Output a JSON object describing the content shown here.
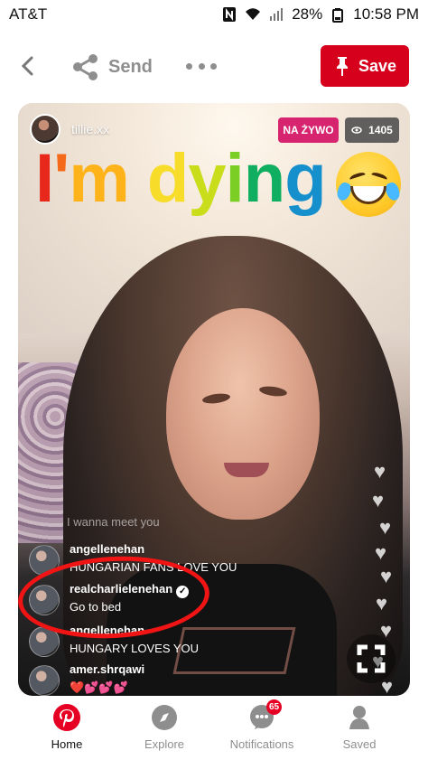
{
  "status_bar": {
    "carrier": "AT&T",
    "battery": "28%",
    "time": "10:58 PM"
  },
  "toolbar": {
    "send_label": "Send",
    "save_label": "Save"
  },
  "live_stream": {
    "username": "tillie.xx",
    "live_badge": "NA ŻYWO",
    "viewers": "1405",
    "caption_text": "I'm dying",
    "caption_colors": [
      "#e7281b",
      "#f46a1a",
      "#ffb31a",
      "#f7dc2a",
      "#c9dd1b",
      "#7bcf24",
      "#10ae60",
      "#168fcd",
      "#2f47b0"
    ],
    "comments": [
      {
        "username": "",
        "text": "I wanna meet you"
      },
      {
        "username": "angellenehan",
        "text": "HUNGARIAN FANS LOVE YOU"
      },
      {
        "username": "realcharlielenehan",
        "text": "Go to bed"
      },
      {
        "username": "angellenehan",
        "text": "HUNGARY LOVES YOU"
      },
      {
        "username": "amer.shrqawi",
        "text": "❤️💕💕💕"
      }
    ]
  },
  "bottom_tabs": [
    {
      "label": "Home",
      "active": true
    },
    {
      "label": "Explore",
      "active": false
    },
    {
      "label": "Notifications",
      "active": false,
      "badge": "65"
    },
    {
      "label": "Saved",
      "active": false
    }
  ],
  "icons": {
    "network": "n-icon",
    "wifi": "wifi-icon",
    "signal": "signal-icon",
    "battery": "battery-icon",
    "back": "back-arrow-icon",
    "send": "share-icon",
    "more": "more-icon",
    "save": "pin-icon",
    "viewer": "eye-icon",
    "emoji": "laughing-face-icon",
    "fullscreen": "fullscreen-icon"
  }
}
